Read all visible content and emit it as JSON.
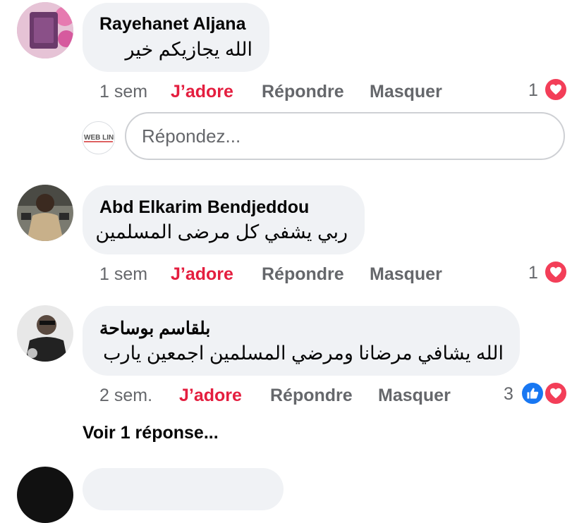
{
  "comments": [
    {
      "author": "Rayehanet Aljana",
      "text": "الله يجازيكم خير",
      "time": "1 sem",
      "like_label": "J’adore",
      "reply_label": "Répondre",
      "hide_label": "Masquer",
      "reaction_count": "1",
      "reactions": [
        "heart-icon"
      ]
    },
    {
      "author": "Abd Elkarim Bendjeddou",
      "text": "ربي يشفي كل مرضى المسلمين",
      "time": "1 sem",
      "like_label": "J’adore",
      "reply_label": "Répondre",
      "hide_label": "Masquer",
      "reaction_count": "1",
      "reactions": [
        "heart-icon"
      ]
    },
    {
      "author": "بلقاسم بوساحة",
      "text": "الله يشافي مرضانا ومرضي المسلمين اجمعين يارب",
      "time": "2 sem.",
      "like_label": "J’adore",
      "reply_label": "Répondre",
      "hide_label": "Masquer",
      "reaction_count": "3",
      "reactions": [
        "thumbs-up-icon",
        "heart-icon"
      ]
    }
  ],
  "reply_box": {
    "placeholder": "Répondez...",
    "avatar_text": "WEB LINE"
  },
  "view_replies": "Voir 1 réponse...",
  "colors": {
    "like_red": "#e41e3f",
    "bubble_gray": "#f0f2f5",
    "meta_gray": "#65676b",
    "heart_red": "#f33e58",
    "like_blue": "#1877f2"
  }
}
